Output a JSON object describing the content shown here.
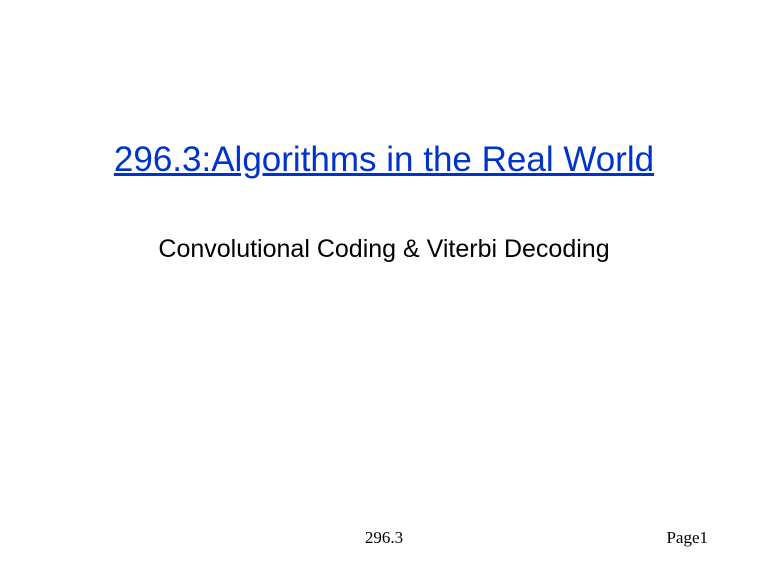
{
  "slide": {
    "title": "296.3:Algorithms in the Real World",
    "subtitle": "Convolutional Coding & Viterbi Decoding"
  },
  "footer": {
    "center": "296.3",
    "right": "Page1"
  }
}
